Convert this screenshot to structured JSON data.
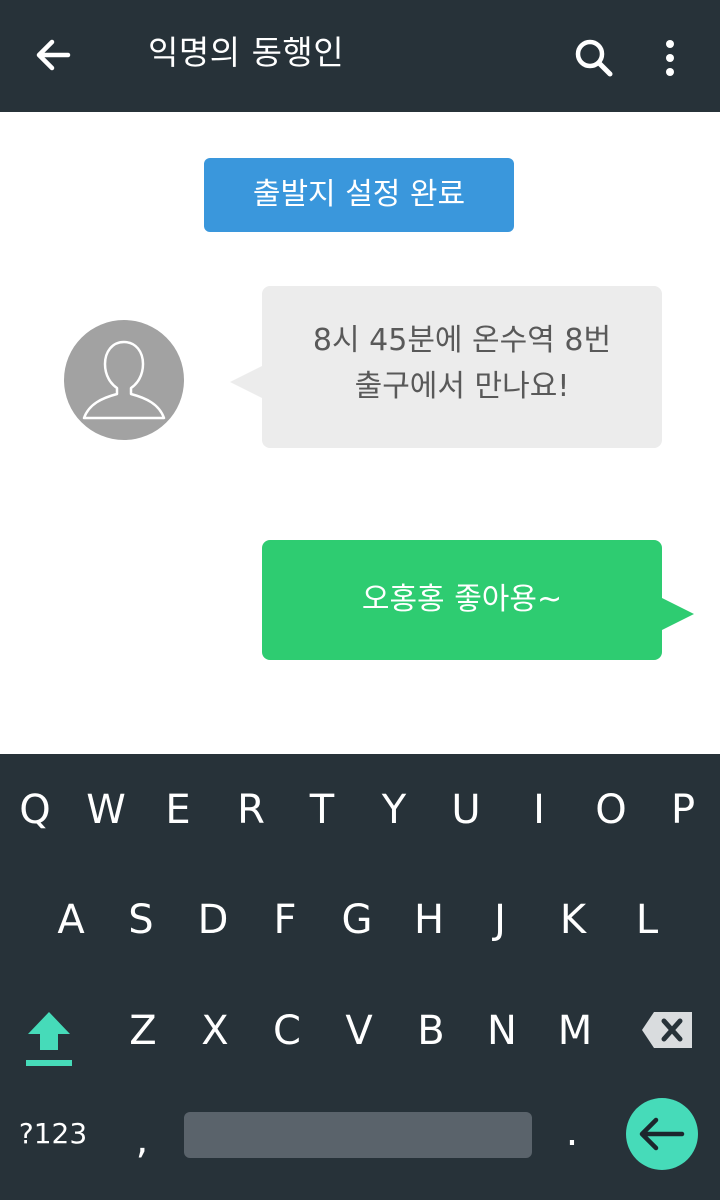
{
  "header": {
    "title": "익명의 동행인",
    "back_icon": "arrow-left-icon",
    "search_icon": "search-icon",
    "more_icon": "more-vertical-icon",
    "background": "#273239"
  },
  "chat": {
    "system_message": "출발지 설정 완료",
    "incoming": {
      "avatar_icon": "user-silhouette-icon",
      "line1": "8시 45분에 온수역 8번",
      "line2": "출구에서 만나요!"
    },
    "outgoing": {
      "text": "오홍홍 좋아용~"
    },
    "colors": {
      "system": "#3a97dc",
      "incoming": "#ececec",
      "outgoing": "#2ecc71",
      "avatar": "#a2a2a2"
    }
  },
  "keyboard": {
    "row1": [
      "Q",
      "W",
      "E",
      "R",
      "T",
      "Y",
      "U",
      "I",
      "O",
      "P"
    ],
    "row2": [
      "A",
      "S",
      "D",
      "F",
      "G",
      "H",
      "J",
      "K",
      "L"
    ],
    "row3": [
      "Z",
      "X",
      "C",
      "V",
      "B",
      "N",
      "M"
    ],
    "symbols_key": "?123",
    "comma_key": ",",
    "period_key": ".",
    "shift_icon": "shift-up-icon",
    "backspace_icon": "backspace-icon",
    "enter_icon": "enter-arrow-icon",
    "accent": "#46dbb9",
    "background": "#273239"
  }
}
